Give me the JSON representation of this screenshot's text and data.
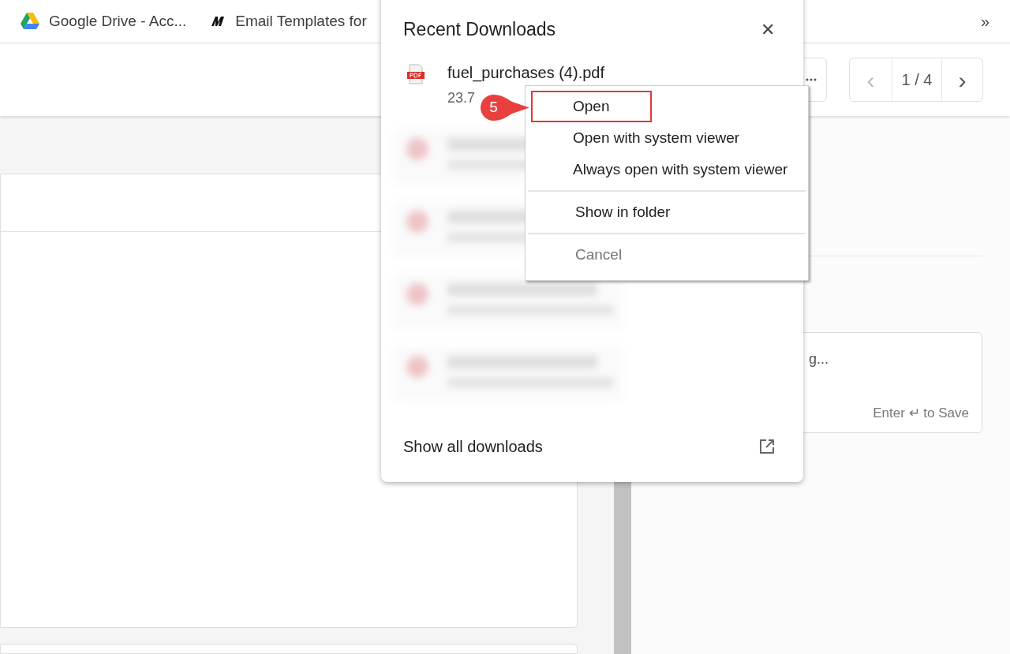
{
  "bookmarks_bar": {
    "items": [
      {
        "kind": "drive",
        "label": "Google Drive - Acc..."
      },
      {
        "kind": "m",
        "label": "Email Templates for"
      }
    ],
    "overflow": "»"
  },
  "toolbar": {
    "pager": {
      "prev": "‹",
      "page": "1 / 4",
      "next": "›"
    }
  },
  "note_field": {
    "placeholder": "g...",
    "hint": "Enter ↵ to Save"
  },
  "downloads_popup": {
    "title": "Recent Downloads",
    "close": "✕",
    "items": [
      {
        "kind": "file",
        "name": "fuel_purchases (4).pdf",
        "size": "23.7"
      },
      {
        "kind": "blurred"
      },
      {
        "kind": "blurred"
      },
      {
        "kind": "blurred"
      },
      {
        "kind": "blurred"
      }
    ],
    "footer": "Show all downloads"
  },
  "context_menu": {
    "groups": [
      [
        {
          "label": "Open",
          "selected": true,
          "disabled": false
        },
        {
          "label": "Open with system viewer",
          "selected": false,
          "disabled": false
        },
        {
          "label": "Always open with system viewer",
          "selected": false,
          "disabled": false
        }
      ],
      [
        {
          "label": "Show in folder",
          "selected": false,
          "disabled": false
        }
      ],
      [
        {
          "label": "Cancel",
          "selected": false,
          "disabled": true
        }
      ]
    ]
  },
  "step_badge": "5"
}
